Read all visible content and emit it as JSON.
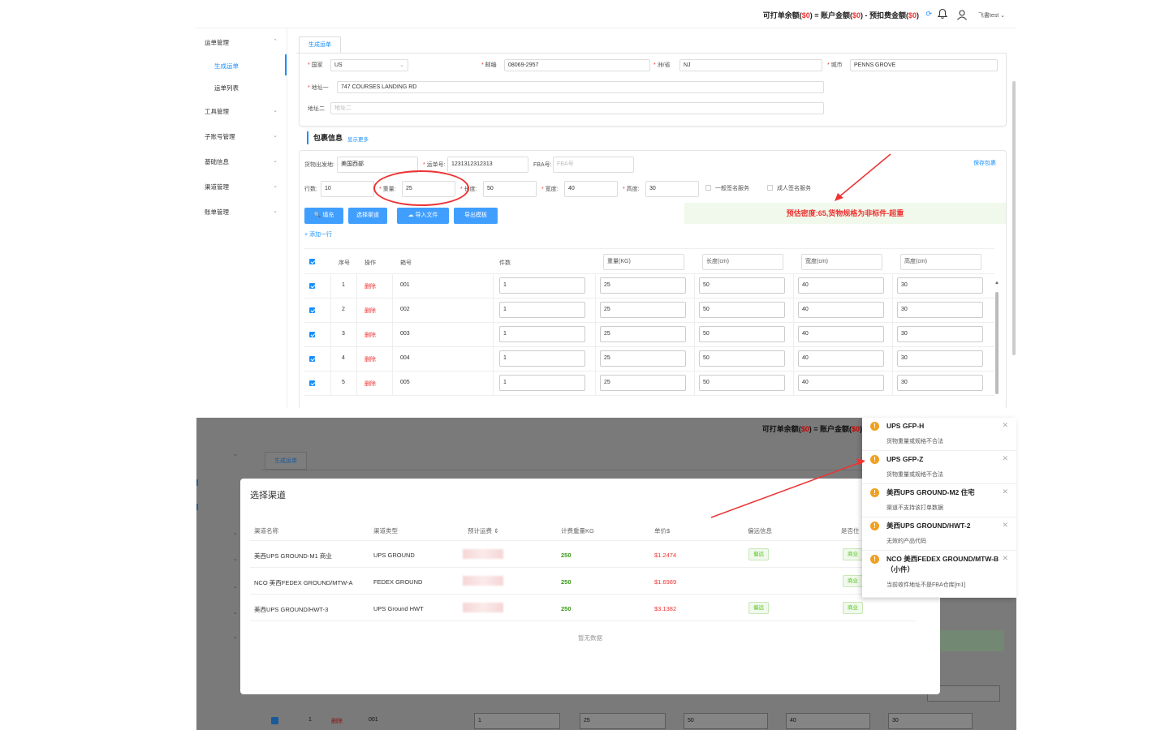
{
  "header": {
    "balance_prefix": "可打单余额(",
    "balance_val1": "$0",
    "balance_mid": ") = 账户金额(",
    "balance_val2": "$0",
    "balance_mid2": ") - 预扣费金额(",
    "balance_val3": "$0",
    "balance_suffix": ")",
    "username": "飞書test",
    "refresh_icon": "refresh-icon",
    "bell_icon": "bell-icon",
    "user_icon": "user-icon"
  },
  "sidebar": {
    "items": [
      {
        "label": "运单管理"
      },
      {
        "label": "工具管理"
      },
      {
        "label": "子账号管理"
      },
      {
        "label": "基础信息"
      },
      {
        "label": "渠道管理"
      },
      {
        "label": "账单管理"
      }
    ],
    "subitems": [
      {
        "label": "生成运单",
        "active": true
      },
      {
        "label": "运单列表",
        "active": false
      }
    ]
  },
  "tab": {
    "label": "生成运单"
  },
  "address": {
    "country_label": "国家",
    "country_value": "US",
    "zip_label": "邮编",
    "zip_value": "08069-2957",
    "state_label": "洲/省",
    "state_value": "NJ",
    "city_label": "城市",
    "city_value": "PENNS GROVE",
    "addr1_label": "地址一",
    "addr1_value": "747 COURSES LANDING RD",
    "addr2_label": "地址二",
    "addr2_placeholder": "地址二"
  },
  "package": {
    "section_title": "包裹信息",
    "show_more": "显示更多",
    "save_link": "保存包裹",
    "origin_label": "货物出发地:",
    "origin_value": "美国西部",
    "tracking_label": "运单号:",
    "tracking_value": "1231312312313",
    "fba_label": "FBA号:",
    "fba_placeholder": "FBA号",
    "rows_label": "行数:",
    "rows_value": "10",
    "weight_label": "重量:",
    "weight_value": "25",
    "length_label": "长度:",
    "length_value": "50",
    "width_label": "宽度:",
    "width_value": "40",
    "height_label": "高度:",
    "height_value": "30",
    "sig1_label": "一般签名服务",
    "sig2_label": "成人签名服务",
    "buttons": {
      "fill": "填充",
      "select_channel": "选择渠道",
      "import": "导入文件",
      "export": "导出模板"
    },
    "add_row": "+ 添加一行",
    "warning": "预估密度:65,货物规格为非标件-超重"
  },
  "table": {
    "headers": {
      "index": "序号",
      "action": "操作",
      "box": "箱号",
      "count": "件数",
      "weight": "重量(KG)",
      "length": "长度(cm)",
      "width": "宽度(cm)",
      "height": "高度(cm)"
    },
    "delete_label": "删除",
    "rows": [
      {
        "idx": "1",
        "box": "001",
        "count": "1",
        "weight": "25",
        "length": "50",
        "width": "40",
        "height": "30"
      },
      {
        "idx": "2",
        "box": "002",
        "count": "1",
        "weight": "25",
        "length": "50",
        "width": "40",
        "height": "30"
      },
      {
        "idx": "3",
        "box": "003",
        "count": "1",
        "weight": "25",
        "length": "50",
        "width": "40",
        "height": "30"
      },
      {
        "idx": "4",
        "box": "004",
        "count": "1",
        "weight": "25",
        "length": "50",
        "width": "40",
        "height": "30"
      },
      {
        "idx": "5",
        "box": "005",
        "count": "1",
        "weight": "25",
        "length": "50",
        "width": "40",
        "height": "30"
      }
    ]
  },
  "modal": {
    "title": "选择渠道",
    "columns": {
      "name": "渠道名称",
      "type": "渠道类型",
      "est_fee": "预计运费 ⇕",
      "bill_weight": "计费重量KG",
      "unit_price": "单价$",
      "remote": "偏远信息",
      "residential": "是否住"
    },
    "rows": [
      {
        "name": "美西UPS GROUND-M1 商业",
        "type": "UPS GROUND",
        "bill_weight": "250",
        "unit_price": "$1.2474",
        "remote": "偏远",
        "residential": "商业"
      },
      {
        "name": "NCO 美西FEDEX GROUND/MTW-A",
        "type": "FEDEX GROUND",
        "bill_weight": "250",
        "unit_price": "$1.6989",
        "remote": "",
        "residential": "商业"
      },
      {
        "name": "美西UPS GROUND/HWT-3",
        "type": "UPS Ground HWT",
        "bill_weight": "250",
        "unit_price": "$3.1382",
        "remote": "偏远",
        "residential": "商业"
      }
    ],
    "empty": "暂无数据"
  },
  "bottom_bg": {
    "balance_prefix": "可打单余额(",
    "balance_val1": "$0",
    "balance_mid": ") = 账户金额(",
    "balance_val2": "$0",
    "balance_suffix": ")",
    "tab": "生成运单",
    "row": {
      "idx": "1",
      "action": "删除",
      "box": "001",
      "count": "1",
      "weight": "25",
      "length": "50",
      "width": "40",
      "height": "30"
    }
  },
  "notifications": [
    {
      "title": "UPS GFP-H",
      "msg": "货物重量或规格不合法"
    },
    {
      "title": "UPS GFP-Z",
      "msg": "货物重量或规格不合法"
    },
    {
      "title": "美西UPS GROUND-M2 住宅",
      "msg": "渠道不支持该打单数据"
    },
    {
      "title": "美西UPS GROUND/HWT-2",
      "msg": "无效的产品代码"
    },
    {
      "title": "NCO 美西FEDEX GROUND/MTW-B（小件）",
      "msg": "当前收件地址不是FBA仓库[m1]"
    }
  ],
  "colors": {
    "primary": "#1890ff",
    "button": "#409eff",
    "danger": "#e33333",
    "warning": "#f0a020",
    "success": "#52c41a"
  }
}
